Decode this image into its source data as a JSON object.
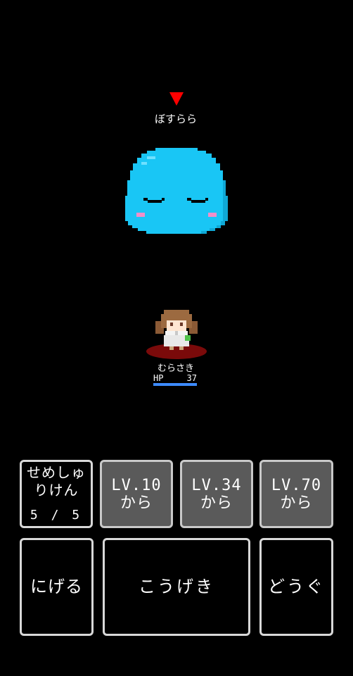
{
  "enemy": {
    "name": "ぼすらら",
    "marker_color": "#ff0000",
    "body_color": "#19c6f5",
    "icon": "slime-monster"
  },
  "hero": {
    "name": "むらさき",
    "hp_label": "HP",
    "hp_value": "37",
    "hp_fraction": 1.0,
    "hp_bar_color": "#3d8bff",
    "icon": "girl-character"
  },
  "commands": {
    "skill": {
      "label_line1": "せめしゅ",
      "label_line2": "りけん",
      "count": "5 / 5"
    },
    "skill_lv10": {
      "line1": "LV.10",
      "line2": "から"
    },
    "skill_lv34": {
      "line1": "LV.34",
      "line2": "から"
    },
    "skill_lv70": {
      "line1": "LV.70",
      "line2": "から"
    },
    "run": "にげる",
    "attack": "こうげき",
    "items": "どうぐ"
  }
}
